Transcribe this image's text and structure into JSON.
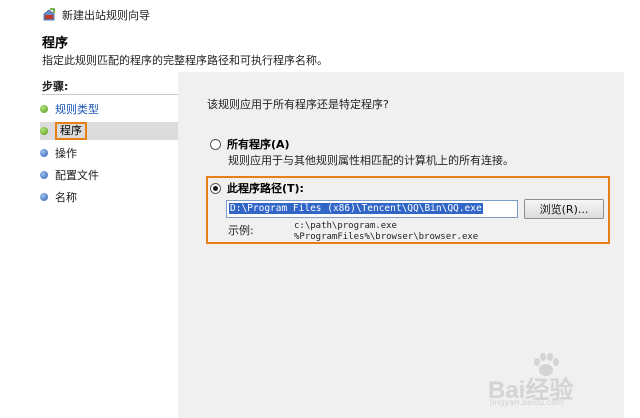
{
  "window": {
    "title": "新建出站规则向导"
  },
  "header": {
    "heading": "程序",
    "description": "指定此规则匹配的程序的完整程序路径和可执行程序名称。"
  },
  "sidebar": {
    "title": "步骤:",
    "items": [
      {
        "label": "规则类型",
        "state": "done"
      },
      {
        "label": "程序",
        "state": "current"
      },
      {
        "label": "操作",
        "state": "todo"
      },
      {
        "label": "配置文件",
        "state": "todo"
      },
      {
        "label": "名称",
        "state": "todo"
      }
    ]
  },
  "main": {
    "question": "该规则应用于所有程序还是特定程序?",
    "option_all": {
      "label": "所有程序(A)",
      "description": "规则应用于与其他规则属性相匹配的计算机上的所有连接。",
      "checked": false
    },
    "option_path": {
      "label": "此程序路径(T):",
      "checked": true,
      "value": "D:\\Program Files (x86)\\Tencent\\QQ\\Bin\\QQ.exe",
      "browse_label": "浏览(R)...",
      "example_label": "示例:",
      "example_line1": "c:\\path\\program.exe",
      "example_line2": "%ProgramFiles%\\browser\\browser.exe"
    }
  },
  "watermark": {
    "text": "Bai经验",
    "sub": "jingyan.baidu.com"
  },
  "colors": {
    "highlight": "#e8801a",
    "selection": "#3165c8",
    "panel": "#f0f0f0"
  }
}
